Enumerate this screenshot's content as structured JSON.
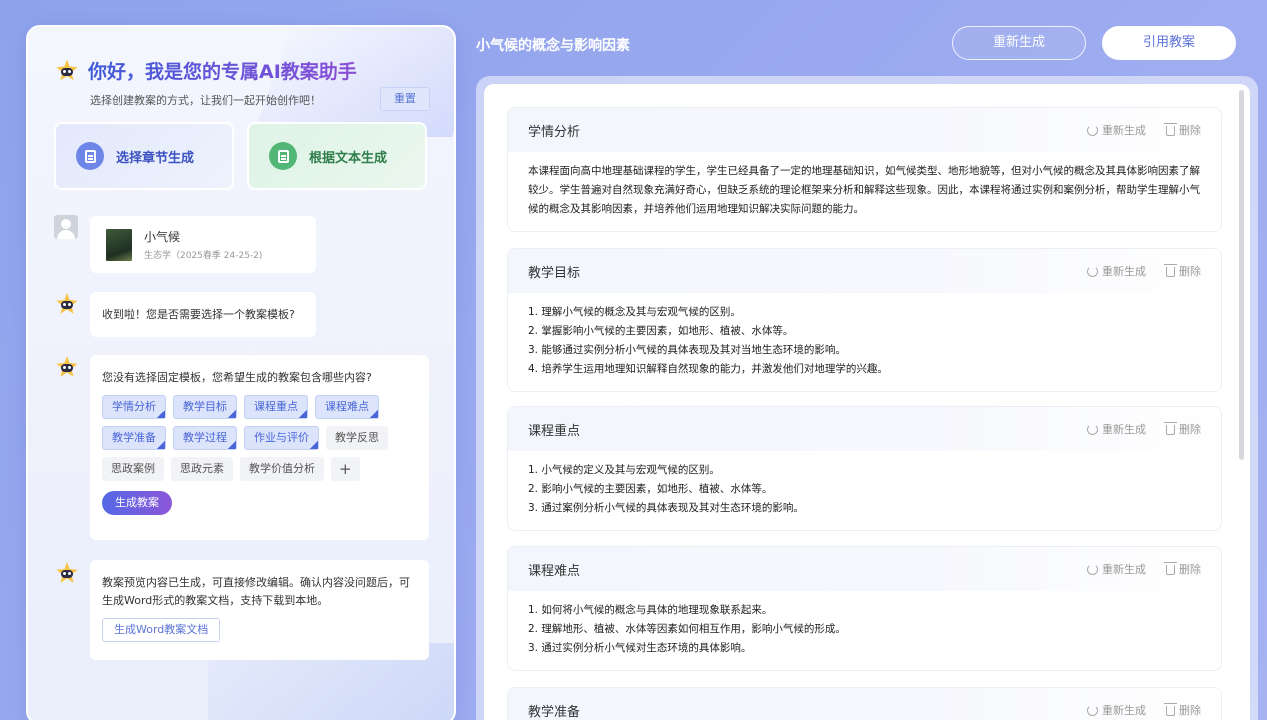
{
  "assistant": {
    "greeting": "你好，我是您的专属AI教案助手",
    "subtitle": "选择创建教案的方式，让我们一起开始创作吧！",
    "reset_label": "重置",
    "modes": [
      {
        "label": "选择章节生成"
      },
      {
        "label": "根据文本生成"
      }
    ],
    "course": {
      "name": "小气候",
      "meta": "生态学（2025春季 24-25-2)"
    },
    "q1": "收到啦！您是否需要选择一个教案模板?",
    "q2": "您没有选择固定模板，您希望生成的教案包含哪些内容?",
    "tags": [
      {
        "label": "学情分析",
        "selected": true
      },
      {
        "label": "教学目标",
        "selected": true
      },
      {
        "label": "课程重点",
        "selected": true
      },
      {
        "label": "课程难点",
        "selected": true
      },
      {
        "label": "教学准备",
        "selected": true
      },
      {
        "label": "教学过程",
        "selected": true
      },
      {
        "label": "作业与评价",
        "selected": true
      },
      {
        "label": "教学反思",
        "selected": false
      },
      {
        "label": "思政案例",
        "selected": false
      },
      {
        "label": "思政元素",
        "selected": false
      },
      {
        "label": "教学价值分析",
        "selected": false
      }
    ],
    "add_tag_label": "+",
    "generate_label": "生成教案",
    "q3": "教案预览内容已生成，可直接修改编辑。确认内容没问题后，可生成Word形式的教案文档，支持下载到本地。",
    "word_label": "生成Word教案文档"
  },
  "header": {
    "title": "小气候的概念与影响因素",
    "regen_label": "重新生成",
    "cite_label": "引用教案"
  },
  "section_actions": {
    "regen": "重新生成",
    "delete": "删除"
  },
  "sections": [
    {
      "title": "学情分析",
      "lines": [
        "本课程面向高中地理基础课程的学生，学生已经具备了一定的地理基础知识，如气候类型、地形地貌等，但对小气候的概念及其具体影响因素了解较少。学生普遍对自然现象充满好奇心，但缺乏系统的理论框架来分析和解释这些现象。因此，本课程将通过实例和案例分析，帮助学生理解小气候的概念及其影响因素，并培养他们运用地理知识解决实际问题的能力。"
      ]
    },
    {
      "title": "教学目标",
      "lines": [
        "1. 理解小气候的概念及其与宏观气候的区别。",
        "2. 掌握影响小气候的主要因素，如地形、植被、水体等。",
        "3. 能够通过实例分析小气候的具体表现及其对当地生态环境的影响。",
        "4. 培养学生运用地理知识解释自然现象的能力，并激发他们对地理学的兴趣。"
      ]
    },
    {
      "title": "课程重点",
      "lines": [
        "1. 小气候的定义及其与宏观气候的区别。",
        "2. 影响小气候的主要因素，如地形、植被、水体等。",
        "3. 通过案例分析小气候的具体表现及其对生态环境的影响。"
      ]
    },
    {
      "title": "课程难点",
      "lines": [
        "1. 如何将小气候的概念与具体的地理现象联系起来。",
        "2. 理解地形、植被、水体等因素如何相互作用，影响小气候的形成。",
        "3. 通过实例分析小气候对生态环境的具体影响。"
      ]
    },
    {
      "title": "教学准备",
      "lines": []
    }
  ]
}
